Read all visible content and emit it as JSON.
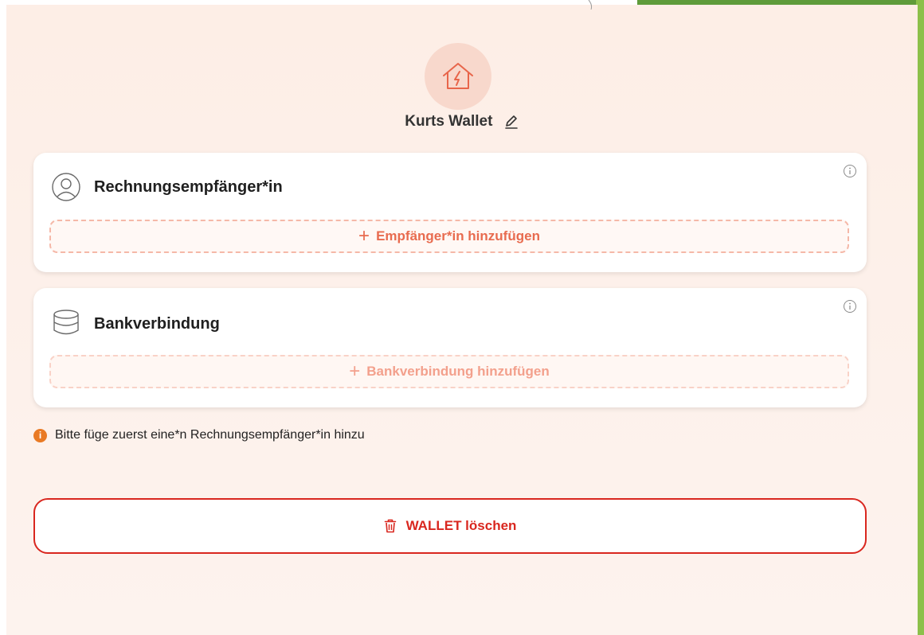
{
  "wallet": {
    "name": "Kurts Wallet"
  },
  "recipient_card": {
    "title": "Rechnungsempfänger*in",
    "add_label": "Empfänger*in hinzufügen"
  },
  "bank_card": {
    "title": "Bankverbindung",
    "add_label": "Bankverbindung hinzufügen"
  },
  "notice": {
    "text": "Bitte füge zuerst eine*n Rechnungsempfänger*in hinzu",
    "icon_glyph": "i"
  },
  "delete_button": {
    "label": "WALLET löschen"
  },
  "icons": {
    "avatar": "house-lightning-icon",
    "edit": "pencil-icon",
    "recipient": "user-circle-icon",
    "bank": "database-icon",
    "info": "info-icon",
    "plus": "plus-icon",
    "trash": "trash-icon"
  },
  "colors": {
    "accent": "#e86b4f",
    "danger": "#d9271f",
    "notice": "#e97a24",
    "avatar_bg": "#f8d8cc",
    "panel_bg": "#fdeee6",
    "green": "#5f9b3a"
  }
}
